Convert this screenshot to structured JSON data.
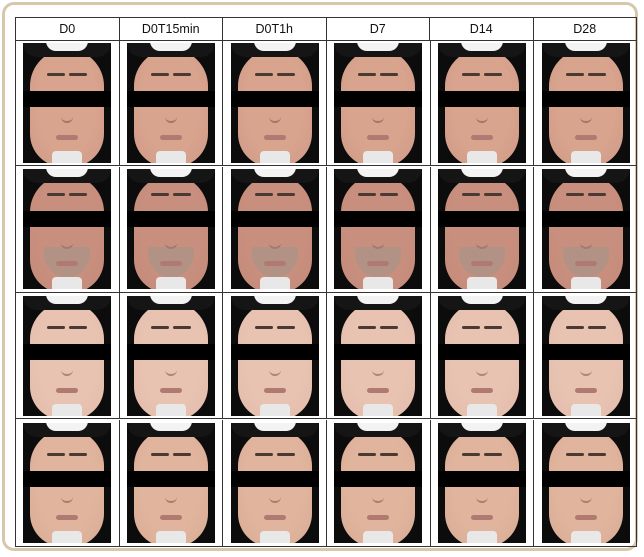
{
  "columns": [
    "D0",
    "D0T15min",
    "D0T1h",
    "D7",
    "D14",
    "D28"
  ],
  "rows": [
    {
      "subject": "subject-1",
      "skin": "#d8a48e",
      "neck": "#cf9a86",
      "beard": false
    },
    {
      "subject": "subject-2",
      "skin": "#c98f7e",
      "neck": "#c48a7a",
      "beard": true
    },
    {
      "subject": "subject-3",
      "skin": "#e9c3b2",
      "neck": "#e2bbaa",
      "beard": false
    },
    {
      "subject": "subject-4",
      "skin": "#e1b59d",
      "neck": "#d8ab94",
      "beard": false
    }
  ],
  "colors": {
    "frame": "#d8c6ad",
    "grid_line": "#333333",
    "photo_background": "#0c0c0c",
    "censor_bar": "#000000"
  }
}
